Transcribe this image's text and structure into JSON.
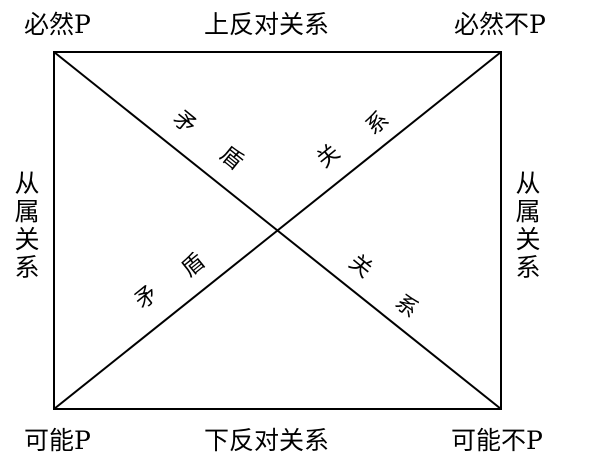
{
  "corners": {
    "top_left": "必然P",
    "top_right": "必然不P",
    "bottom_left": "可能P",
    "bottom_right": "可能不P"
  },
  "edges": {
    "top": "上反对关系",
    "bottom": "下反对关系",
    "left": "从属关系",
    "right": "从属关系"
  },
  "diagonals": {
    "upper_left_segment": [
      "矛",
      "盾"
    ],
    "upper_right_segment": [
      "关",
      "系"
    ],
    "lower_left_segment": [
      "矛",
      "盾"
    ],
    "lower_right_segment": [
      "关",
      "系"
    ]
  },
  "colors": {
    "line": "#000000",
    "text": "#000000",
    "background": "#ffffff"
  }
}
